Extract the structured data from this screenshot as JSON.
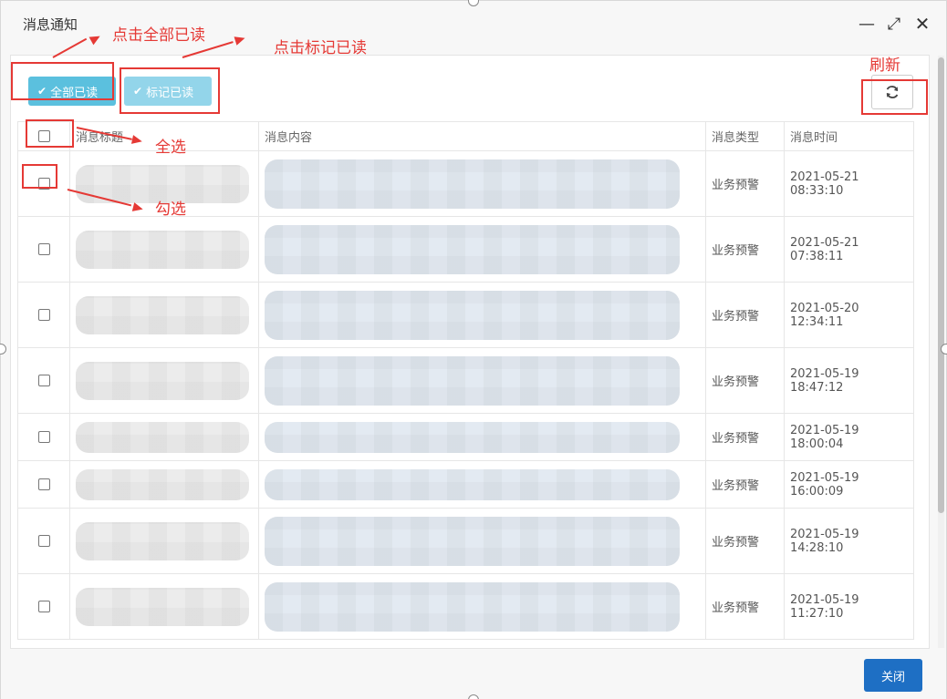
{
  "window": {
    "title": "消息通知",
    "controls": {
      "minimize": "—",
      "maximize": "⤢",
      "close": "✕"
    }
  },
  "toolbar": {
    "mark_all_read_label": "全部已读",
    "mark_read_label": "标记已读",
    "check_glyph": "✔",
    "refresh_glyph": "⟳"
  },
  "table": {
    "headers": {
      "title": "消息标题",
      "content": "消息内容",
      "type": "消息类型",
      "time": "消息时间"
    },
    "rows": [
      {
        "type": "业务预警",
        "time": "2021-05-21 08:33:10"
      },
      {
        "type": "业务预警",
        "time": "2021-05-21 07:38:11"
      },
      {
        "type": "业务预警",
        "time": "2021-05-20 12:34:11"
      },
      {
        "type": "业务预警",
        "time": "2021-05-19 18:47:12"
      },
      {
        "type": "业务预警",
        "time": "2021-05-19 18:00:04"
      },
      {
        "type": "业务预警",
        "time": "2021-05-19 16:00:09"
      },
      {
        "type": "业务预警",
        "time": "2021-05-19 14:28:10"
      },
      {
        "type": "业务预警",
        "time": "2021-05-19 11:27:10"
      }
    ]
  },
  "footer": {
    "close_label": "关闭"
  },
  "annotations": {
    "mark_all_read": "点击全部已读",
    "mark_read": "点击标记已读",
    "refresh": "刷新",
    "select_all": "全选",
    "check_one": "勾选"
  },
  "colors": {
    "primary_button": "#5bc0de",
    "secondary_button": "#93d5ea",
    "close_button": "#1e6fc4",
    "annotation": "#e53935"
  }
}
